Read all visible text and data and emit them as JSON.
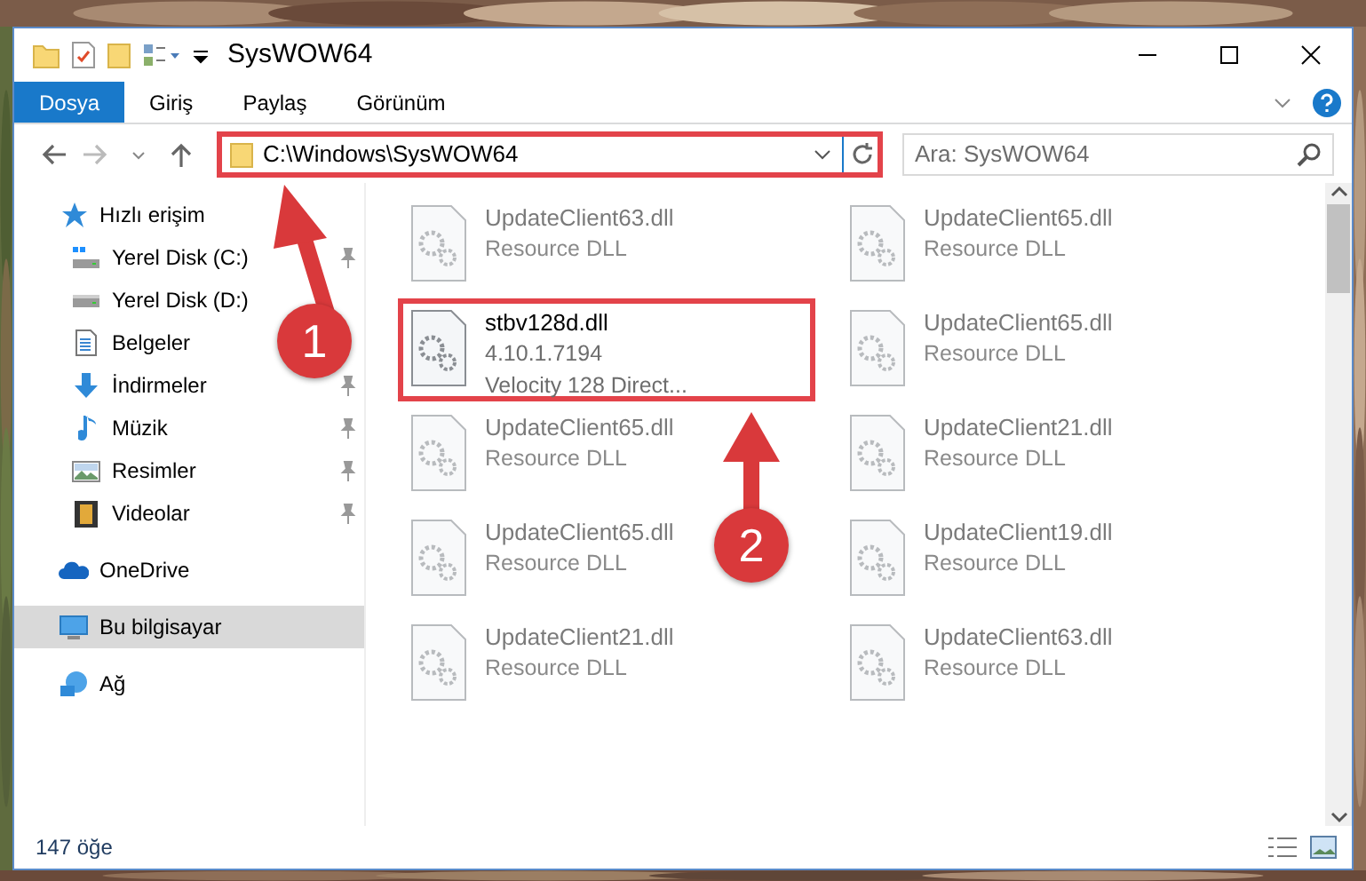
{
  "title_bar": {
    "title": "SysWOW64"
  },
  "ribbon_tabs": [
    {
      "label": "Dosya",
      "selected": true
    },
    {
      "label": "Giriş",
      "selected": false
    },
    {
      "label": "Paylaş",
      "selected": false
    },
    {
      "label": "Görünüm",
      "selected": false
    }
  ],
  "address_bar": {
    "path": "C:\\Windows\\SysWOW64",
    "highlighted": true
  },
  "search": {
    "placeholder": "Ara: SysWOW64"
  },
  "nav_pane": [
    {
      "label": "Hızlı erişim",
      "kind": "star",
      "selected": false,
      "children": [
        {
          "label": "Yerel Disk (C:)",
          "kind": "drive-c",
          "pinned": true,
          "selected": false
        },
        {
          "label": "Yerel Disk (D:)",
          "kind": "drive",
          "pinned": false,
          "selected": false
        },
        {
          "label": "Belgeler",
          "kind": "documents",
          "pinned": false,
          "selected": false
        },
        {
          "label": "İndirmeler",
          "kind": "downloads",
          "pinned": true,
          "selected": false
        },
        {
          "label": "Müzik",
          "kind": "music",
          "pinned": true,
          "selected": false
        },
        {
          "label": "Resimler",
          "kind": "pictures",
          "pinned": true,
          "selected": false
        },
        {
          "label": "Videolar",
          "kind": "videos",
          "pinned": true,
          "selected": false
        }
      ]
    },
    {
      "label": "OneDrive",
      "kind": "cloud",
      "selected": false
    },
    {
      "label": "Bu bilgisayar",
      "kind": "computer",
      "selected": true
    },
    {
      "label": "Ağ",
      "kind": "network",
      "selected": false
    }
  ],
  "files": [
    {
      "name": "UpdateClient63.dll",
      "description": "Resource DLL",
      "blurred": true,
      "highlighted": false
    },
    {
      "name": "UpdateClient65.dll",
      "description": "Resource DLL",
      "blurred": true,
      "highlighted": false
    },
    {
      "name": "stbv128d.dll",
      "version": "4.10.1.7194",
      "description": "Velocity 128 Direct...",
      "blurred": false,
      "highlighted": true
    },
    {
      "name": "UpdateClient65.dll",
      "description": "Resource DLL",
      "blurred": true,
      "highlighted": false
    },
    {
      "name": "UpdateClient65.dll",
      "description": "Resource DLL",
      "blurred": true,
      "highlighted": false
    },
    {
      "name": "UpdateClient21.dll",
      "description": "Resource DLL",
      "blurred": true,
      "highlighted": false
    },
    {
      "name": "UpdateClient65.dll",
      "description": "Resource DLL",
      "blurred": true,
      "highlighted": false
    },
    {
      "name": "UpdateClient19.dll",
      "description": "Resource DLL",
      "blurred": true,
      "highlighted": false
    },
    {
      "name": "UpdateClient21.dll",
      "description": "Resource DLL",
      "blurred": true,
      "highlighted": false
    },
    {
      "name": "UpdateClient63.dll",
      "description": "Resource DLL",
      "blurred": true,
      "highlighted": false
    }
  ],
  "status_bar": {
    "item_count": "147 öğe"
  },
  "callouts": [
    {
      "number": "1"
    },
    {
      "number": "2"
    }
  ]
}
